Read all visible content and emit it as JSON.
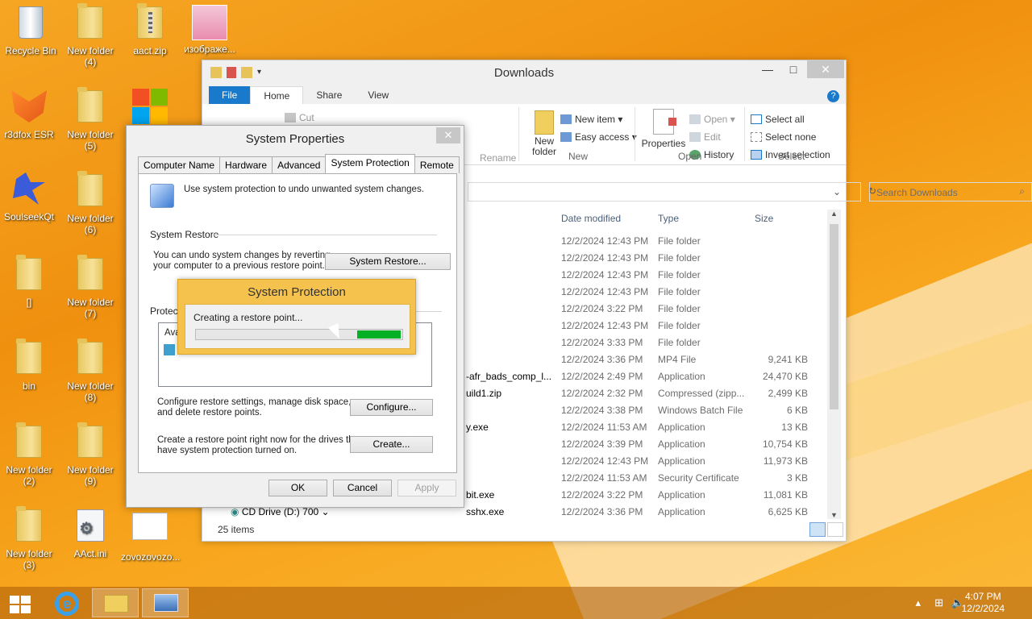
{
  "desktop": {
    "icons": [
      {
        "label": "Recycle Bin",
        "kind": "recycle-bin-icon"
      },
      {
        "label": "New folder\n(4)",
        "kind": "folder-icon"
      },
      {
        "label": "aact.zip",
        "kind": "zip-folder-icon"
      },
      {
        "label": "изображе...",
        "kind": "image-file-icon"
      },
      {
        "label": "r3dfox ESR",
        "kind": "fox-browser-icon"
      },
      {
        "label": "New folder\n(5)",
        "kind": "folder-icon"
      },
      {
        "label": "SoulseekQt",
        "kind": "bird-app-icon"
      },
      {
        "label": "New folder\n(6)",
        "kind": "folder-icon"
      },
      {
        "label": "[]",
        "kind": "folder-icon"
      },
      {
        "label": "New folder\n(7)",
        "kind": "folder-icon"
      },
      {
        "label": "bin",
        "kind": "folder-icon"
      },
      {
        "label": "New folder\n(8)",
        "kind": "folder-icon"
      },
      {
        "label": "New folder\n(2)",
        "kind": "folder-icon"
      },
      {
        "label": "New folder\n(9)",
        "kind": "folder-icon"
      },
      {
        "label": "New folder\n(3)",
        "kind": "folder-icon"
      },
      {
        "label": "AAct.ini",
        "kind": "ini-file-icon"
      },
      {
        "label": "zovozovozo...",
        "kind": "document-icon"
      }
    ]
  },
  "explorer": {
    "title": "Downloads",
    "tabs": [
      "File",
      "Home",
      "Share",
      "View"
    ],
    "ribbon": {
      "cut": "Cut",
      "rename": "Rename",
      "new_folder": "New\nfolder",
      "new_item": "New item ▾",
      "easy_access": "Easy access ▾",
      "group_new": "New",
      "properties": "Properties",
      "open": "Open ▾",
      "edit": "Edit",
      "history": "History",
      "group_open": "Open",
      "select_all": "Select all",
      "select_none": "Select none",
      "invert_selection": "Invert selection",
      "group_select": "Select"
    },
    "search_placeholder": "Search Downloads",
    "columns": {
      "date": "Date modified",
      "type": "Type",
      "size": "Size"
    },
    "rows": [
      {
        "name": "",
        "date": "12/2/2024 12:43 PM",
        "type": "File folder",
        "size": ""
      },
      {
        "name": "",
        "date": "12/2/2024 12:43 PM",
        "type": "File folder",
        "size": ""
      },
      {
        "name": "",
        "date": "12/2/2024 12:43 PM",
        "type": "File folder",
        "size": ""
      },
      {
        "name": "",
        "date": "12/2/2024 12:43 PM",
        "type": "File folder",
        "size": ""
      },
      {
        "name": "",
        "date": "12/2/2024 3:22 PM",
        "type": "File folder",
        "size": ""
      },
      {
        "name": "",
        "date": "12/2/2024 12:43 PM",
        "type": "File folder",
        "size": ""
      },
      {
        "name": "",
        "date": "12/2/2024 3:33 PM",
        "type": "File folder",
        "size": ""
      },
      {
        "name": "",
        "date": "12/2/2024 3:36 PM",
        "type": "MP4 File",
        "size": "9,241 KB"
      },
      {
        "name": "-afr_bads_comp_l...",
        "date": "12/2/2024 2:49 PM",
        "type": "Application",
        "size": "24,470 KB"
      },
      {
        "name": "uild1.zip",
        "date": "12/2/2024 2:32 PM",
        "type": "Compressed (zipp...",
        "size": "2,499 KB"
      },
      {
        "name": "",
        "date": "12/2/2024 3:38 PM",
        "type": "Windows Batch File",
        "size": "6 KB"
      },
      {
        "name": "y.exe",
        "date": "12/2/2024 11:53 AM",
        "type": "Application",
        "size": "13 KB"
      },
      {
        "name": "",
        "date": "12/2/2024 3:39 PM",
        "type": "Application",
        "size": "10,754 KB"
      },
      {
        "name": "",
        "date": "12/2/2024 12:43 PM",
        "type": "Application",
        "size": "11,973 KB"
      },
      {
        "name": "",
        "date": "12/2/2024 11:53 AM",
        "type": "Security Certificate",
        "size": "3 KB"
      },
      {
        "name": "bit.exe",
        "date": "12/2/2024 3:22 PM",
        "type": "Application",
        "size": "11,081 KB"
      },
      {
        "name": "sshx.exe",
        "date": "12/2/2024 3:36 PM",
        "type": "Application",
        "size": "6,625 KB"
      }
    ],
    "nav_item": "CD Drive (D:) 700",
    "status": "25 items"
  },
  "sysprop": {
    "title": "System Properties",
    "tabs": [
      "Computer Name",
      "Hardware",
      "Advanced",
      "System Protection",
      "Remote"
    ],
    "intro": "Use system protection to undo unwanted system changes.",
    "restore_header": "System Restore",
    "restore_text": "You can undo system changes by reverting\nyour computer to a previous restore point.",
    "restore_button": "System Restore...",
    "protection_header": "Protecti",
    "list_label": "Ava",
    "configure_text": "Configure restore settings, manage disk space,\nand delete restore points.",
    "configure_button": "Configure...",
    "create_text": "Create a restore point right now for the drives that\nhave system protection turned on.",
    "create_button": "Create...",
    "ok": "OK",
    "cancel": "Cancel",
    "apply": "Apply"
  },
  "progress_popup": {
    "title": "System Protection",
    "message": "Creating a restore point...",
    "progress_fill_start": 0.78,
    "progress_fill_end": 0.99,
    "fill_color": "#06b025"
  },
  "taskbar": {
    "time": "4:07 PM",
    "date": "12/2/2024"
  }
}
